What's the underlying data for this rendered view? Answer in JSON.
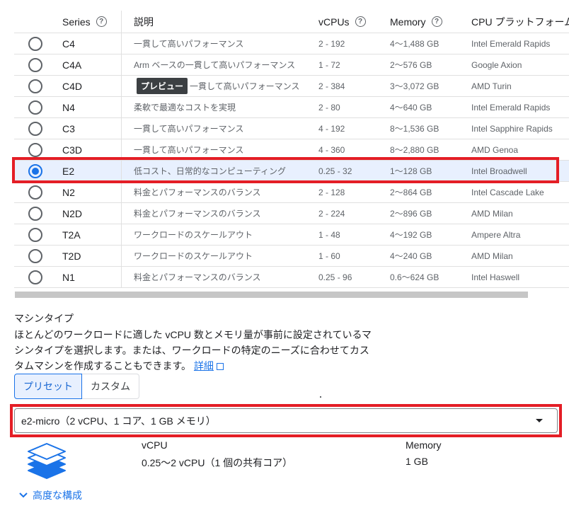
{
  "table": {
    "headers": {
      "series": "Series",
      "description": "説明",
      "vcpus": "vCPUs",
      "memory": "Memory",
      "platform": "CPU プラットフォーム"
    },
    "selected_series": "E2",
    "rows": [
      {
        "series": "C4",
        "badge": "",
        "description": "一貫して高いパフォーマンス",
        "vcpus": "2 - 192",
        "memory": "4～1,488 GB",
        "platform": "Intel Emerald Rapids",
        "selected": false
      },
      {
        "series": "C4A",
        "badge": "",
        "description": "Arm ベースの一貫して高いパフォーマンス",
        "vcpus": "1 - 72",
        "memory": "2～576 GB",
        "platform": "Google Axion",
        "selected": false
      },
      {
        "series": "C4D",
        "badge": "プレビュー",
        "description": "一貫して高いパフォーマンス",
        "vcpus": "2 - 384",
        "memory": "3～3,072 GB",
        "platform": "AMD Turin",
        "selected": false
      },
      {
        "series": "N4",
        "badge": "",
        "description": "柔軟で最適なコストを実現",
        "vcpus": "2 - 80",
        "memory": "4～640 GB",
        "platform": "Intel Emerald Rapids",
        "selected": false
      },
      {
        "series": "C3",
        "badge": "",
        "description": "一貫して高いパフォーマンス",
        "vcpus": "4 - 192",
        "memory": "8～1,536 GB",
        "platform": "Intel Sapphire Rapids",
        "selected": false
      },
      {
        "series": "C3D",
        "badge": "",
        "description": "一貫して高いパフォーマンス",
        "vcpus": "4 - 360",
        "memory": "8～2,880 GB",
        "platform": "AMD Genoa",
        "selected": false
      },
      {
        "series": "E2",
        "badge": "",
        "description": "低コスト、日常的なコンピューティング",
        "vcpus": "0.25 - 32",
        "memory": "1～128 GB",
        "platform": "Intel Broadwell",
        "selected": true
      },
      {
        "series": "N2",
        "badge": "",
        "description": "料金とパフォーマンスのバランス",
        "vcpus": "2 - 128",
        "memory": "2～864 GB",
        "platform": "Intel Cascade Lake",
        "selected": false
      },
      {
        "series": "N2D",
        "badge": "",
        "description": "料金とパフォーマンスのバランス",
        "vcpus": "2 - 224",
        "memory": "2～896 GB",
        "platform": "AMD Milan",
        "selected": false
      },
      {
        "series": "T2A",
        "badge": "",
        "description": "ワークロードのスケールアウト",
        "vcpus": "1 - 48",
        "memory": "4～192 GB",
        "platform": "Ampere Altra",
        "selected": false
      },
      {
        "series": "T2D",
        "badge": "",
        "description": "ワークロードのスケールアウト",
        "vcpus": "1 - 60",
        "memory": "4～240 GB",
        "platform": "AMD Milan",
        "selected": false
      },
      {
        "series": "N1",
        "badge": "",
        "description": "料金とパフォーマンスのバランス",
        "vcpus": "0.25 - 96",
        "memory": "0.6～624 GB",
        "platform": "Intel Haswell",
        "selected": false
      }
    ]
  },
  "machine_type": {
    "title": "マシンタイプ",
    "description_line1": "ほとんどのワークロードに適した vCPU 数とメモリ量が事前に設定されているマ",
    "description_line2": "シンタイプを選択します。または、ワークロードの特定のニーズに合わせてカス",
    "description_line3": "タムマシンを作成することもできます。",
    "details_link": "詳細",
    "tabs": {
      "preset": "プリセット",
      "custom": "カスタム"
    },
    "active_tab": "preset",
    "selected_value": "e2-micro（2 vCPU、1 コア、1 GB メモリ）",
    "spec": {
      "vcpu_label": "vCPU",
      "vcpu_value": "0.25～2 vCPU（1 個の共有コア）",
      "memory_label": "Memory",
      "memory_value": "1 GB"
    },
    "advanced_label": "高度な構成"
  },
  "colors": {
    "accent": "#1a73e8",
    "highlight_border": "#e41e26",
    "selected_row_bg": "#e8f0fe",
    "badge_bg": "#3c4043"
  },
  "icons": {
    "help": "help-circle-icon",
    "machine": "stacked-layers-icon",
    "expand": "chevron-down-icon",
    "external": "external-link-icon",
    "dropdown": "caret-down-icon"
  }
}
